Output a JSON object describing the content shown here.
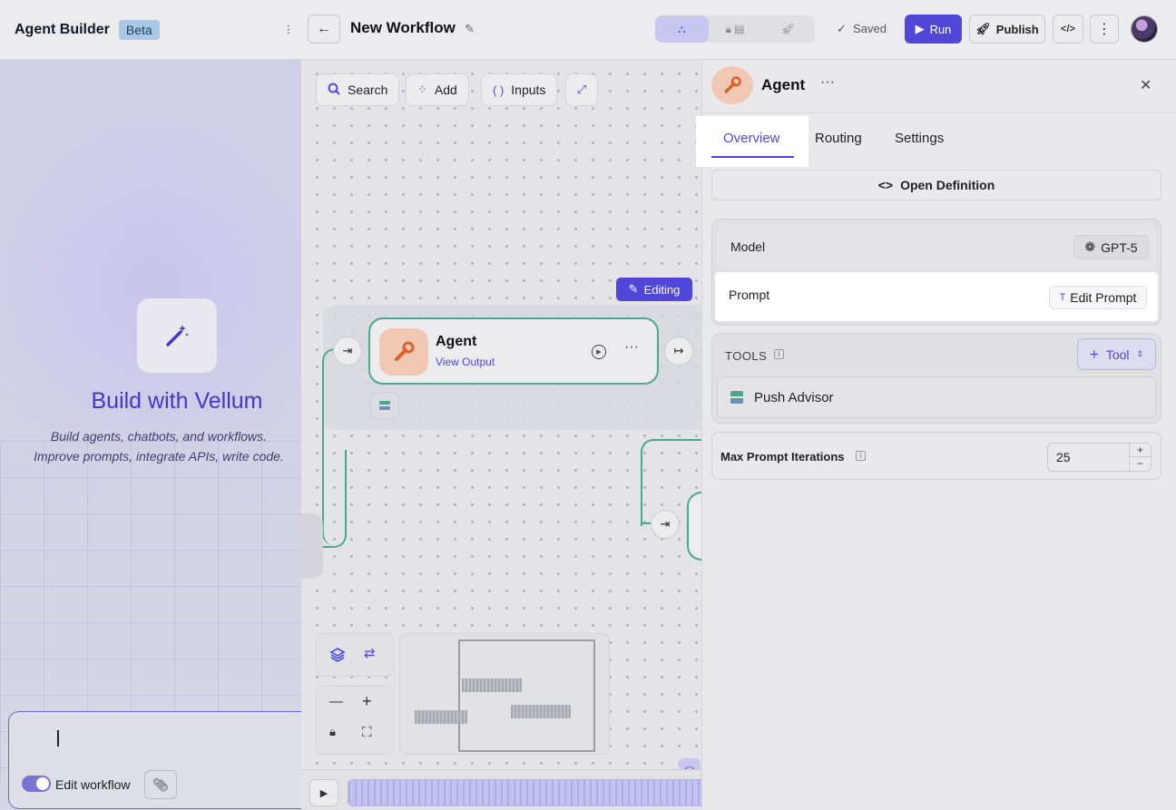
{
  "header": {
    "app_title": "Agent Builder",
    "beta_badge": "Beta",
    "workflow_title": "New Workflow",
    "saved_label": "Saved",
    "run_label": "Run",
    "publish_label": "Publish",
    "code_label": "</>",
    "back_glyph": "←",
    "more_glyph": "⋮"
  },
  "left_panel": {
    "title": "Build with Vellum",
    "subtitle_line1": "Build agents, chatbots, and workflows.",
    "subtitle_line2": "Improve prompts, integrate APIs, write code.",
    "edit_workflow_label": "Edit workflow",
    "edit_workflow_enabled": true
  },
  "canvas": {
    "toolbar": [
      {
        "label": "Search",
        "icon": "search-icon",
        "glyph": "🔍"
      },
      {
        "label": "Add",
        "icon": "add-grid-icon",
        "glyph": "⁘"
      },
      {
        "label": "Inputs",
        "icon": "braces-icon",
        "glyph": "{ }"
      }
    ],
    "editing_badge": "Editing",
    "node": {
      "name": "Agent",
      "link": "View Output"
    }
  },
  "right_panel": {
    "title": "Agent",
    "tabs": [
      {
        "label": "Overview",
        "active": true
      },
      {
        "label": "Routing",
        "active": false
      },
      {
        "label": "Settings",
        "active": false
      }
    ],
    "open_definition": "Open Definition",
    "model_label": "Model",
    "model_value": "GPT-5",
    "prompt_label": "Prompt",
    "edit_prompt": "Edit Prompt",
    "tools_label": "TOOLS",
    "add_tool": "Tool",
    "tools": [
      {
        "name": "Push Advisor"
      }
    ],
    "max_iterations_label": "Max Prompt Iterations",
    "max_iterations_value": "25"
  },
  "colors": {
    "accent": "#4f46e5",
    "run_button": "#5046d8",
    "edge_green": "#4aa98a",
    "beta_badge": "#a8c8e6"
  }
}
